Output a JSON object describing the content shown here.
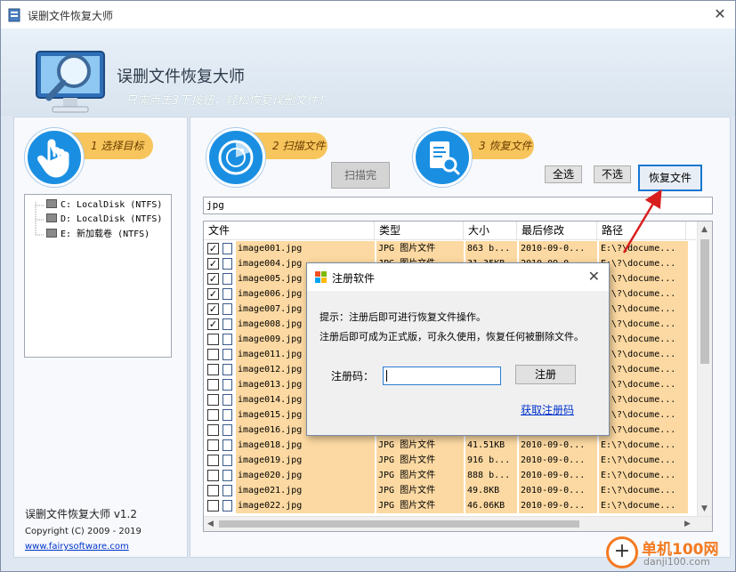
{
  "window": {
    "title": "误删文件恢复大师",
    "close_glyph": "✕"
  },
  "header": {
    "app_title": "误删文件恢复大师",
    "slogan": "只需点击3下按钮，轻松恢复误删文件！"
  },
  "steps": [
    {
      "label": "1 选择目标",
      "icon": "hand-pointer-icon"
    },
    {
      "label": "2 扫描文件",
      "icon": "radar-scan-icon"
    },
    {
      "label": "3 恢复文件",
      "icon": "document-search-icon"
    }
  ],
  "drives": [
    {
      "label": "C: LocalDisk (NTFS)"
    },
    {
      "label": "D: LocalDisk (NTFS)"
    },
    {
      "label": "E: 新加载卷 (NTFS)"
    }
  ],
  "footer": {
    "version": "误删文件恢复大师 v1.2",
    "copyright": "Copyright (C) 2009 - 2019",
    "website": "www.fairysoftware.com"
  },
  "toolbar": {
    "scan_done": "扫描完",
    "select_all": "全选",
    "unselect": "不选",
    "recover": "恢复文件"
  },
  "filter": {
    "value": "jpg"
  },
  "table": {
    "columns": [
      "文件",
      "类型",
      "大小",
      "最后修改",
      "路径"
    ],
    "rows": [
      {
        "checked": true,
        "name": "image001.jpg",
        "type": "JPG 图片文件",
        "size": "863 b...",
        "modified": "2010-09-0...",
        "path": "E:\\?\\docume..."
      },
      {
        "checked": true,
        "name": "image004.jpg",
        "type": "JPG 图片文件",
        "size": "31.35KB",
        "modified": "2010-09-0...",
        "path": "E:\\?\\docume..."
      },
      {
        "checked": true,
        "name": "image005.jpg",
        "type": "JPG 图片文件",
        "size": "",
        "modified": "",
        "path": "E:\\?\\docume..."
      },
      {
        "checked": true,
        "name": "image006.jpg",
        "type": "",
        "size": "",
        "modified": "",
        "path": "E:\\?\\docume..."
      },
      {
        "checked": true,
        "name": "image007.jpg",
        "type": "",
        "size": "",
        "modified": "",
        "path": "E:\\?\\docume..."
      },
      {
        "checked": true,
        "name": "image008.jpg",
        "type": "",
        "size": "",
        "modified": "",
        "path": "E:\\?\\docume..."
      },
      {
        "checked": false,
        "name": "image009.jpg",
        "type": "",
        "size": "",
        "modified": "",
        "path": "E:\\?\\docume..."
      },
      {
        "checked": false,
        "name": "image011.jpg",
        "type": "",
        "size": "",
        "modified": "",
        "path": "E:\\?\\docume..."
      },
      {
        "checked": false,
        "name": "image012.jpg",
        "type": "",
        "size": "",
        "modified": "",
        "path": "E:\\?\\docume..."
      },
      {
        "checked": false,
        "name": "image013.jpg",
        "type": "",
        "size": "",
        "modified": "",
        "path": "E:\\?\\docume..."
      },
      {
        "checked": false,
        "name": "image014.jpg",
        "type": "",
        "size": "",
        "modified": "",
        "path": "E:\\?\\docume..."
      },
      {
        "checked": false,
        "name": "image015.jpg",
        "type": "",
        "size": "",
        "modified": "",
        "path": "E:\\?\\docume..."
      },
      {
        "checked": false,
        "name": "image016.jpg",
        "type": "",
        "size": "",
        "modified": "",
        "path": "E:\\?\\docume..."
      },
      {
        "checked": false,
        "name": "image018.jpg",
        "type": "JPG 图片文件",
        "size": "41.51KB",
        "modified": "2010-09-0...",
        "path": "E:\\?\\docume..."
      },
      {
        "checked": false,
        "name": "image019.jpg",
        "type": "JPG 图片文件",
        "size": "916 b...",
        "modified": "2010-09-0...",
        "path": "E:\\?\\docume..."
      },
      {
        "checked": false,
        "name": "image020.jpg",
        "type": "JPG 图片文件",
        "size": "888 b...",
        "modified": "2010-09-0...",
        "path": "E:\\?\\docume..."
      },
      {
        "checked": false,
        "name": "image021.jpg",
        "type": "JPG 图片文件",
        "size": "49.8KB",
        "modified": "2010-09-0...",
        "path": "E:\\?\\docume..."
      },
      {
        "checked": false,
        "name": "image022.jpg",
        "type": "JPG 图片文件",
        "size": "46.06KB",
        "modified": "2010-09-0...",
        "path": "E:\\?\\docume..."
      }
    ]
  },
  "dialog": {
    "title": "注册软件",
    "hint_line1": "提示：注册后即可进行恢复文件操作。",
    "hint_line2": "注册后即可成为正式版，可永久使用，恢复任何被删除文件。",
    "code_label": "注册码：",
    "code_value": "",
    "register_button": "注册",
    "get_code_link": "获取注册码"
  },
  "watermark": {
    "name": "单机100网",
    "url": "danji100.com"
  },
  "colors": {
    "accent_blue": "#1a8fe2",
    "step_badge": "#f7c55b",
    "row_highlight": "#fcd9a2",
    "arrow_red": "#d91e1e"
  }
}
